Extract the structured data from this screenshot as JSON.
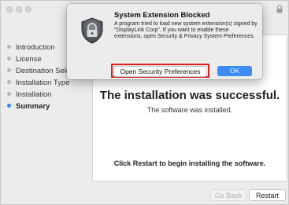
{
  "sidebar": {
    "items": [
      {
        "label": "Introduction"
      },
      {
        "label": "License"
      },
      {
        "label": "Destination Sele"
      },
      {
        "label": "Installation Type"
      },
      {
        "label": "Installation"
      },
      {
        "label": "Summary"
      }
    ]
  },
  "main": {
    "heading": "The installation was successful.",
    "subtext": "The software was installed.",
    "restart_note": "Click Restart to begin installing the software."
  },
  "buttons": {
    "go_back": "Go Back",
    "restart": "Restart"
  },
  "dialog": {
    "title": "System Extension Blocked",
    "body": "A program tried to load new system extension(s) signed by \"DisplayLink Corp\". If you want to enable these extensions, open Security & Privacy System Preferences.",
    "open_prefs_label": "Open Security Preferences",
    "ok_label": "OK"
  },
  "colors": {
    "accent": "#3b8cf5",
    "highlight_box": "#e11d1d"
  },
  "icons": [
    "lock-icon",
    "security-shield-icon"
  ]
}
